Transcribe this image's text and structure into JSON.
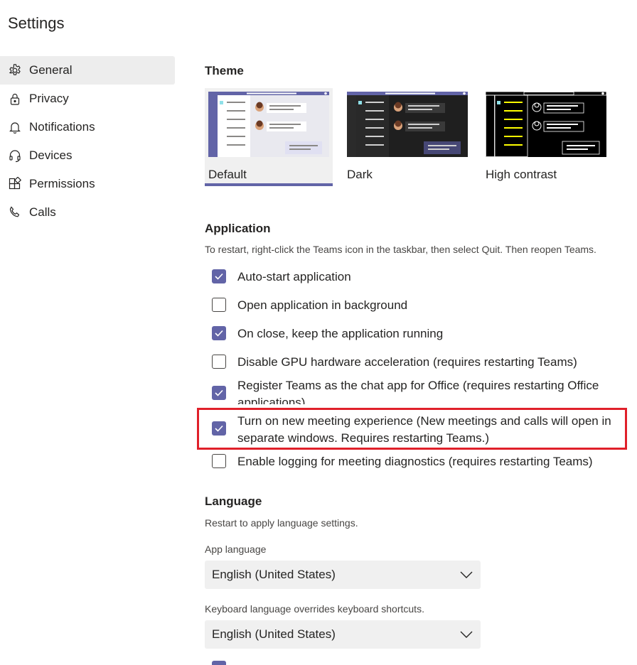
{
  "page": {
    "title": "Settings"
  },
  "colors": {
    "accent": "#6264a7",
    "highlight": "#e0202a",
    "nav_active_bg": "#ededed"
  },
  "nav": {
    "items": [
      {
        "label": "General",
        "icon": "gear-icon",
        "active": true
      },
      {
        "label": "Privacy",
        "icon": "lock-icon",
        "active": false
      },
      {
        "label": "Notifications",
        "icon": "bell-icon",
        "active": false
      },
      {
        "label": "Devices",
        "icon": "headset-icon",
        "active": false
      },
      {
        "label": "Permissions",
        "icon": "apps-icon",
        "active": false
      },
      {
        "label": "Calls",
        "icon": "phone-icon",
        "active": false
      }
    ]
  },
  "theme": {
    "title": "Theme",
    "options": [
      {
        "label": "Default",
        "selected": true
      },
      {
        "label": "Dark",
        "selected": false
      },
      {
        "label": "High contrast",
        "selected": false
      }
    ]
  },
  "application": {
    "title": "Application",
    "hint": "To restart, right-click the Teams icon in the taskbar, then select Quit. Then reopen Teams.",
    "options": [
      {
        "label": "Auto-start application",
        "checked": true
      },
      {
        "label": "Open application in background",
        "checked": false
      },
      {
        "label": "On close, keep the application running",
        "checked": true
      },
      {
        "label": "Disable GPU hardware acceleration (requires restarting Teams)",
        "checked": false
      },
      {
        "label": "Register Teams as the chat app for Office (requires restarting Office applications)",
        "checked": true
      },
      {
        "label": "Turn on new meeting experience (New meetings and calls will open in separate windows. Requires restarting Teams.)",
        "checked": true
      },
      {
        "label": "Enable logging for meeting diagnostics (requires restarting Teams)",
        "checked": false
      }
    ]
  },
  "language": {
    "title": "Language",
    "hint": "Restart to apply language settings.",
    "app_language_label": "App language",
    "app_language_value": "English (United States)",
    "keyboard_label": "Keyboard language overrides keyboard shortcuts.",
    "keyboard_value": "English (United States)"
  }
}
